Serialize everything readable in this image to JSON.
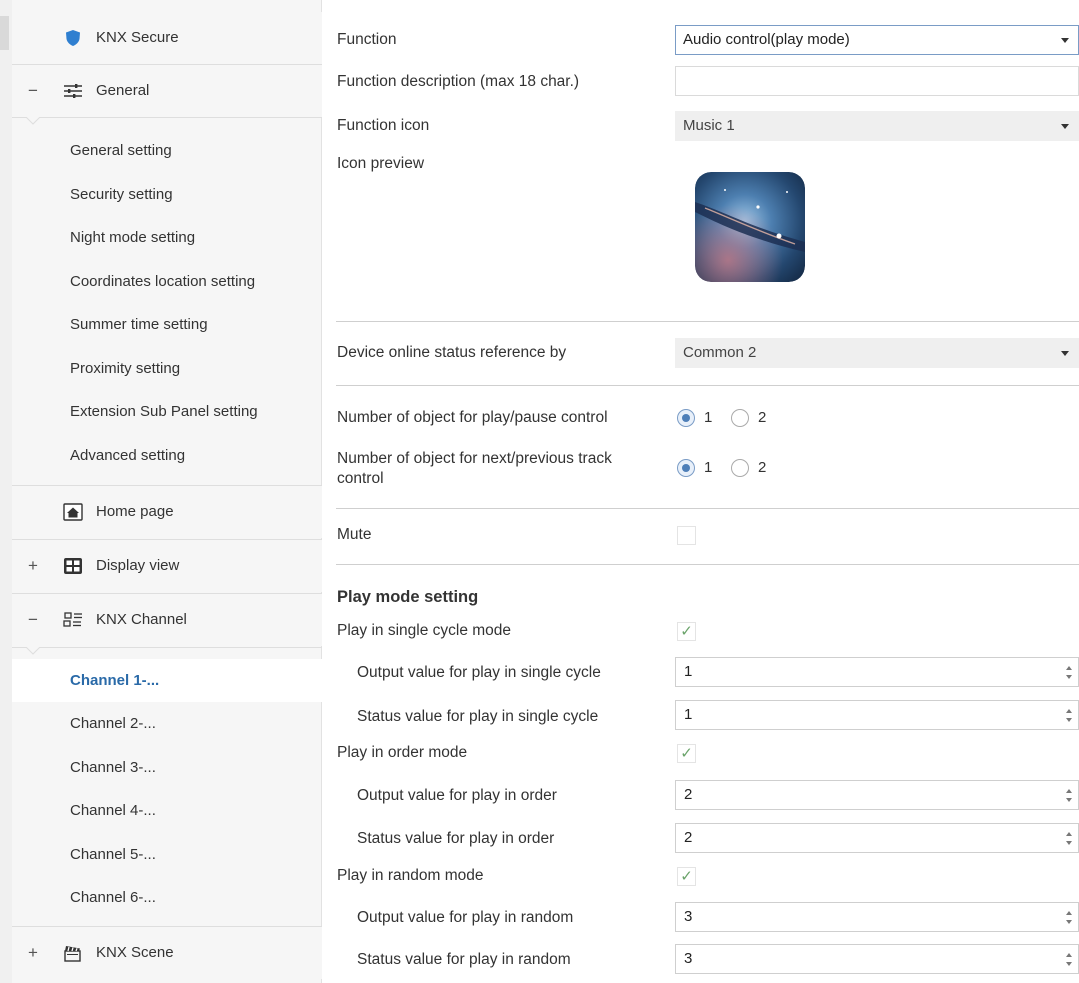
{
  "sidebar": {
    "knx_secure": "KNX Secure",
    "general": {
      "sign": "−",
      "label": "General"
    },
    "general_items": [
      "General setting",
      "Security setting",
      "Night mode setting",
      "Coordinates location setting",
      "Summer time setting",
      "Proximity setting",
      "Extension Sub Panel setting",
      "Advanced setting"
    ],
    "home_page": "Home page",
    "display_view": {
      "sign": "+",
      "label": "Display view"
    },
    "knx_channel": {
      "sign": "−",
      "label": "KNX Channel"
    },
    "channels": [
      "Channel 1-...",
      "Channel 2-...",
      "Channel 3-...",
      "Channel 4-...",
      "Channel 5-...",
      "Channel 6-..."
    ],
    "knx_scene": {
      "sign": "+",
      "label": "KNX Scene"
    },
    "icons": {
      "knx_secure": "shield-icon",
      "general": "sliders-icon",
      "home_page": "home-icon",
      "display_view": "grid-icon",
      "knx_channel": "channel-icon",
      "knx_scene": "clapperboard-icon"
    }
  },
  "main": {
    "function": {
      "label": "Function",
      "value": "Audio control(play mode)"
    },
    "function_description": {
      "label": "Function description (max 18 char.)",
      "value": ""
    },
    "function_icon": {
      "label": "Function icon",
      "value": "Music 1"
    },
    "icon_preview": {
      "label": "Icon preview"
    },
    "device_online": {
      "label": "Device online status reference by",
      "value": "Common 2"
    },
    "play_pause_objects": {
      "label": "Number of object for play/pause control",
      "options": [
        "1",
        "2"
      ],
      "selected": "1"
    },
    "next_prev_objects": {
      "label_line1": "Number of object for next/previous track",
      "label_line2": "control",
      "options": [
        "1",
        "2"
      ],
      "selected": "1"
    },
    "mute": {
      "label": "Mute",
      "checked": false
    },
    "play_mode_setting": "Play mode setting",
    "single_cycle": {
      "label": "Play in single cycle mode",
      "checked": true,
      "output_label": "Output value for play in single cycle",
      "output_value": "1",
      "status_label": "Status value for  play in single cycle",
      "status_value": "1"
    },
    "order": {
      "label": "Play in order mode",
      "checked": true,
      "output_label": "Output value for play in order",
      "output_value": "2",
      "status_label": "Status value for play in order",
      "status_value": "2"
    },
    "random": {
      "label": "Play in random mode",
      "checked": true,
      "output_label": "Output value for play in random",
      "output_value": "3",
      "status_label": "Status value for play in random",
      "status_value": "3"
    },
    "check_mark": "✓"
  },
  "colors": {
    "active_link": "#2a6aa8",
    "select_border": "#7a9cc6",
    "check": "#6aa36a"
  }
}
